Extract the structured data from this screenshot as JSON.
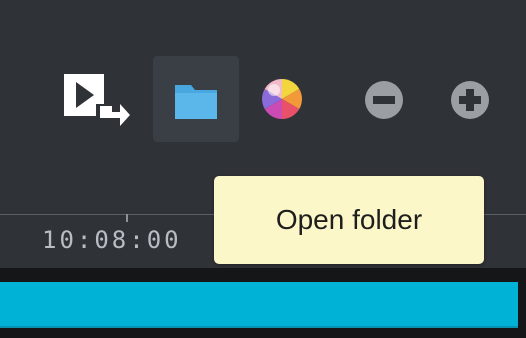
{
  "toolbar": {
    "buttons": [
      {
        "id": "export",
        "icon": "export-video-icon"
      },
      {
        "id": "open-folder",
        "icon": "folder-icon",
        "active": true
      },
      {
        "id": "color",
        "icon": "color-wheel-icon"
      },
      {
        "id": "zoom-out",
        "icon": "zoom-out-icon"
      },
      {
        "id": "zoom-in",
        "icon": "zoom-in-icon"
      }
    ]
  },
  "tooltip": {
    "text": "Open folder"
  },
  "ruler": {
    "time_label": "10:08:00"
  },
  "colors": {
    "background": "#2f3237",
    "active_button": "#3a3e45",
    "folder_icon": "#49a7df",
    "tooltip_bg": "#fbf7c9",
    "track": "#00b2d6",
    "timeline_bg": "#151617"
  }
}
